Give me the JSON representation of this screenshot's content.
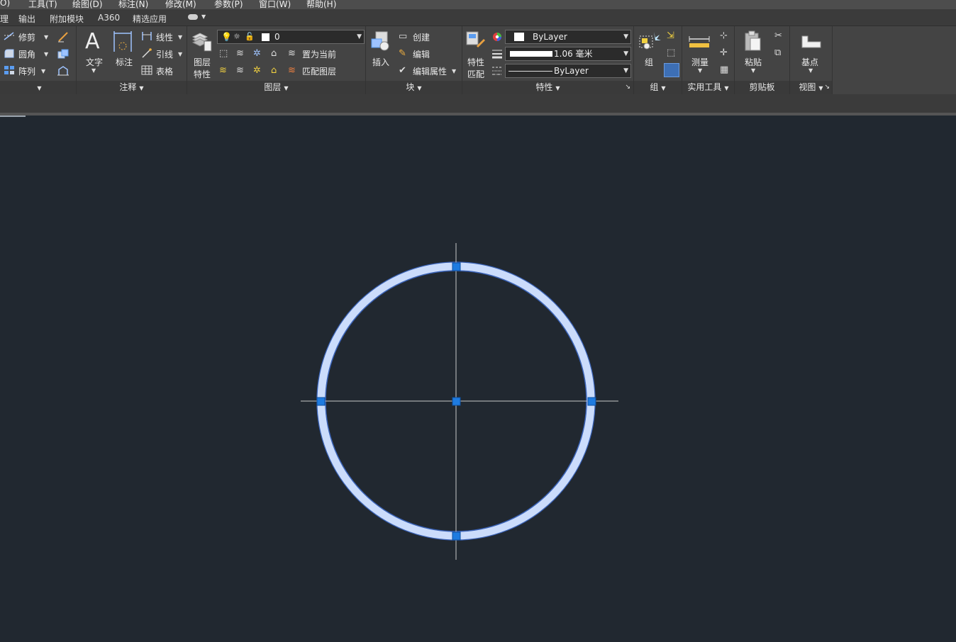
{
  "menu": {
    "items": [
      "O)",
      "工具(T)",
      "绘图(D)",
      "标注(N)",
      "修改(M)",
      "参数(P)",
      "窗口(W)",
      "帮助(H)"
    ]
  },
  "tabs": {
    "items": [
      "理",
      "输出",
      "附加模块",
      "A360",
      "精选应用"
    ]
  },
  "modify": {
    "trim": "修剪",
    "fillet": "圆角",
    "array": "阵列"
  },
  "annotation": {
    "text": "文字",
    "dimension": "标注",
    "linear": "线性",
    "leader": "引线",
    "table": "表格",
    "title": "注释"
  },
  "layers": {
    "properties_line1": "图层",
    "properties_line2": "特性",
    "current_layer": "0",
    "set_current": "置为当前",
    "match_layer": "匹配图层",
    "title": "图层"
  },
  "block": {
    "insert": "插入",
    "create": "创建",
    "edit": "编辑",
    "edit_attributes": "编辑属性",
    "title": "块"
  },
  "properties": {
    "match_line1": "特性",
    "match_line2": "匹配",
    "color": "ByLayer",
    "lineweight": "1.06 毫米",
    "linetype": "ByLayer",
    "title": "特性"
  },
  "groups": {
    "group": "组",
    "title": "组"
  },
  "utilities": {
    "measure": "测量",
    "title": "实用工具"
  },
  "clipboard": {
    "paste": "粘贴",
    "title": "剪贴板"
  },
  "view": {
    "base_point": "基点",
    "title": "视图"
  },
  "colors": {
    "circle_fill": "#cbdcfb",
    "circle_edge": "#3a63b8",
    "grip": "#1e7be0",
    "crosshair": "#c8c8c8",
    "canvas": "#212830"
  }
}
